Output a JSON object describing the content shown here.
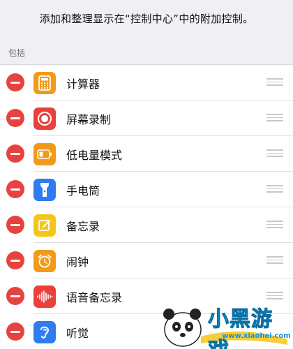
{
  "header": {
    "description": "添加和整理显示在“控制中心”中的附加控制。"
  },
  "section": {
    "title": "包括"
  },
  "controls": [
    {
      "label": "计算器",
      "icon": "calculator-icon",
      "color": "#f29a18"
    },
    {
      "label": "屏幕录制",
      "icon": "screen-record-icon",
      "color": "#e9403c"
    },
    {
      "label": "低电量模式",
      "icon": "battery-icon",
      "color": "#f29a18"
    },
    {
      "label": "手电筒",
      "icon": "flashlight-icon",
      "color": "#2f7cf0"
    },
    {
      "label": "备忘录",
      "icon": "notes-icon",
      "color": "#f5c518"
    },
    {
      "label": "闹钟",
      "icon": "alarm-icon",
      "color": "#f29a18"
    },
    {
      "label": "语音备忘录",
      "icon": "voice-memo-icon",
      "color": "#e9403c"
    },
    {
      "label": "听觉",
      "icon": "hearing-icon",
      "color": "#2f7cf0"
    }
  ],
  "watermark": {
    "brand": "小黑游戏",
    "url": "www.xiaohei.com"
  }
}
